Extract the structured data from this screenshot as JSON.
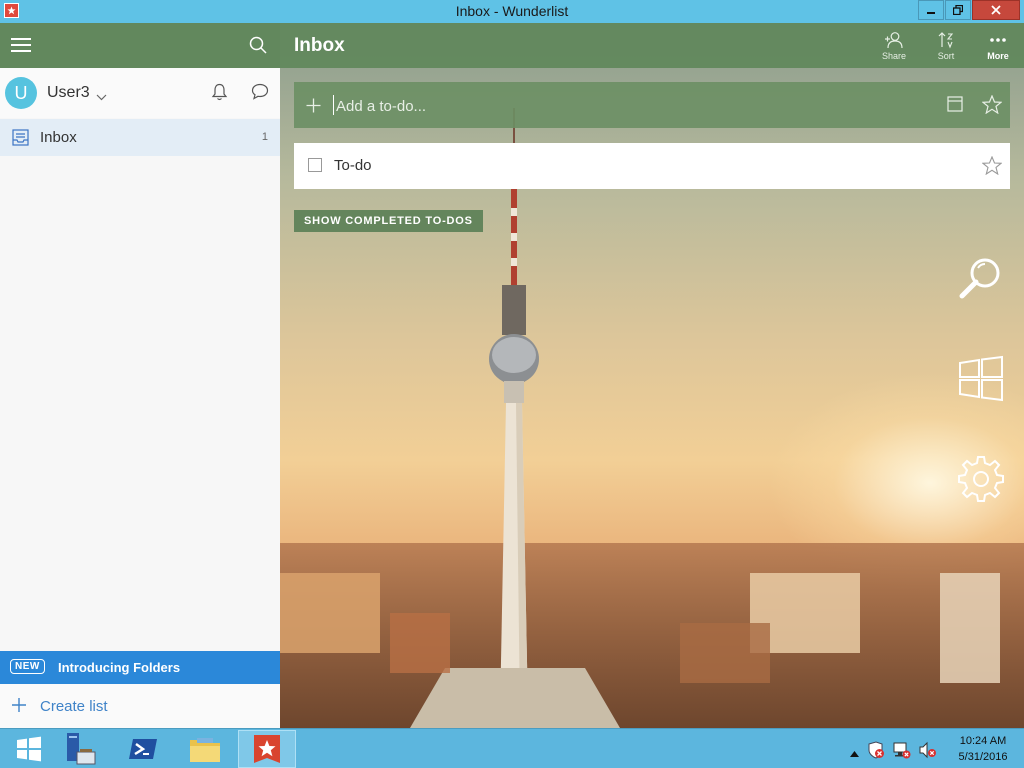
{
  "window": {
    "title": "Inbox - Wunderlist"
  },
  "sidebar": {
    "user": {
      "initial": "U",
      "name": "User3"
    },
    "lists": [
      {
        "label": "Inbox",
        "count": "1"
      }
    ],
    "banner": {
      "badge": "NEW",
      "text": "Introducing Folders"
    },
    "create_list": "Create list"
  },
  "main": {
    "title": "Inbox",
    "toolbar": {
      "share": "Share",
      "sort": "Sort",
      "more": "More"
    },
    "add_placeholder": "Add a to-do...",
    "todos": [
      {
        "label": "To-do",
        "done": false,
        "starred": false
      }
    ],
    "show_completed": "SHOW COMPLETED TO-DOS"
  },
  "taskbar": {
    "time": "10:24 AM",
    "date": "5/31/2016"
  },
  "colors": {
    "header_green": "#62885d",
    "accent_blue": "#2b88d9",
    "titlebar_blue": "#5fc2e6",
    "close_red": "#c6483c",
    "avatar": "#56c3df"
  }
}
